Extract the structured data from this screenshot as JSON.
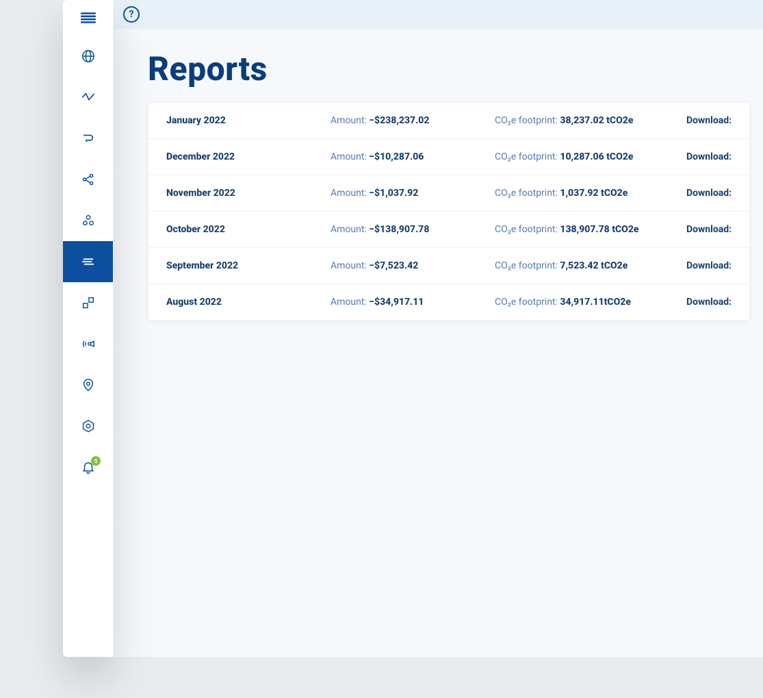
{
  "page": {
    "title": "Reports"
  },
  "topbar": {
    "help_glyph": "?"
  },
  "sidebar": {
    "menu_toggle_name": "main-menu",
    "items": [
      {
        "id": "globe",
        "icon": "globe-icon",
        "active": false
      },
      {
        "id": "activity",
        "icon": "activity-icon",
        "active": false
      },
      {
        "id": "path",
        "icon": "path-icon",
        "active": false
      },
      {
        "id": "network",
        "icon": "share-icon",
        "active": false
      },
      {
        "id": "clusters",
        "icon": "clusters-icon",
        "active": false
      },
      {
        "id": "reports",
        "icon": "lines-icon",
        "active": true
      },
      {
        "id": "modules",
        "icon": "modules-icon",
        "active": false
      },
      {
        "id": "broadcast",
        "icon": "broadcast-icon",
        "active": false
      },
      {
        "id": "location",
        "icon": "pin-icon",
        "active": false
      },
      {
        "id": "settings",
        "icon": "hex-icon",
        "active": false
      },
      {
        "id": "alerts",
        "icon": "bell-icon",
        "active": false,
        "badge": "5"
      }
    ]
  },
  "table": {
    "columns": {
      "amount_label": "Amount: ",
      "footprint_label": "CO₂e footprint: ",
      "download_label": "Download:"
    },
    "rows": [
      {
        "period": "January 2022",
        "amount": "−$238,237.02",
        "footprint": "38,237.02 tCO2e"
      },
      {
        "period": "December 2022",
        "amount": "−$10,287.06",
        "footprint": "10,287.06 tCO2e"
      },
      {
        "period": "November 2022",
        "amount": "−$1,037.92",
        "footprint": "1,037.92 tCO2e"
      },
      {
        "period": "October 2022",
        "amount": "−$138,907.78",
        "footprint": "138,907.78 tCO2e"
      },
      {
        "period": "September 2022",
        "amount": "−$7,523.42",
        "footprint": "7,523.42 tCO2e"
      },
      {
        "period": "August 2022",
        "amount": "−$34,917.11",
        "footprint": "34,917.11tCO2e"
      }
    ]
  }
}
